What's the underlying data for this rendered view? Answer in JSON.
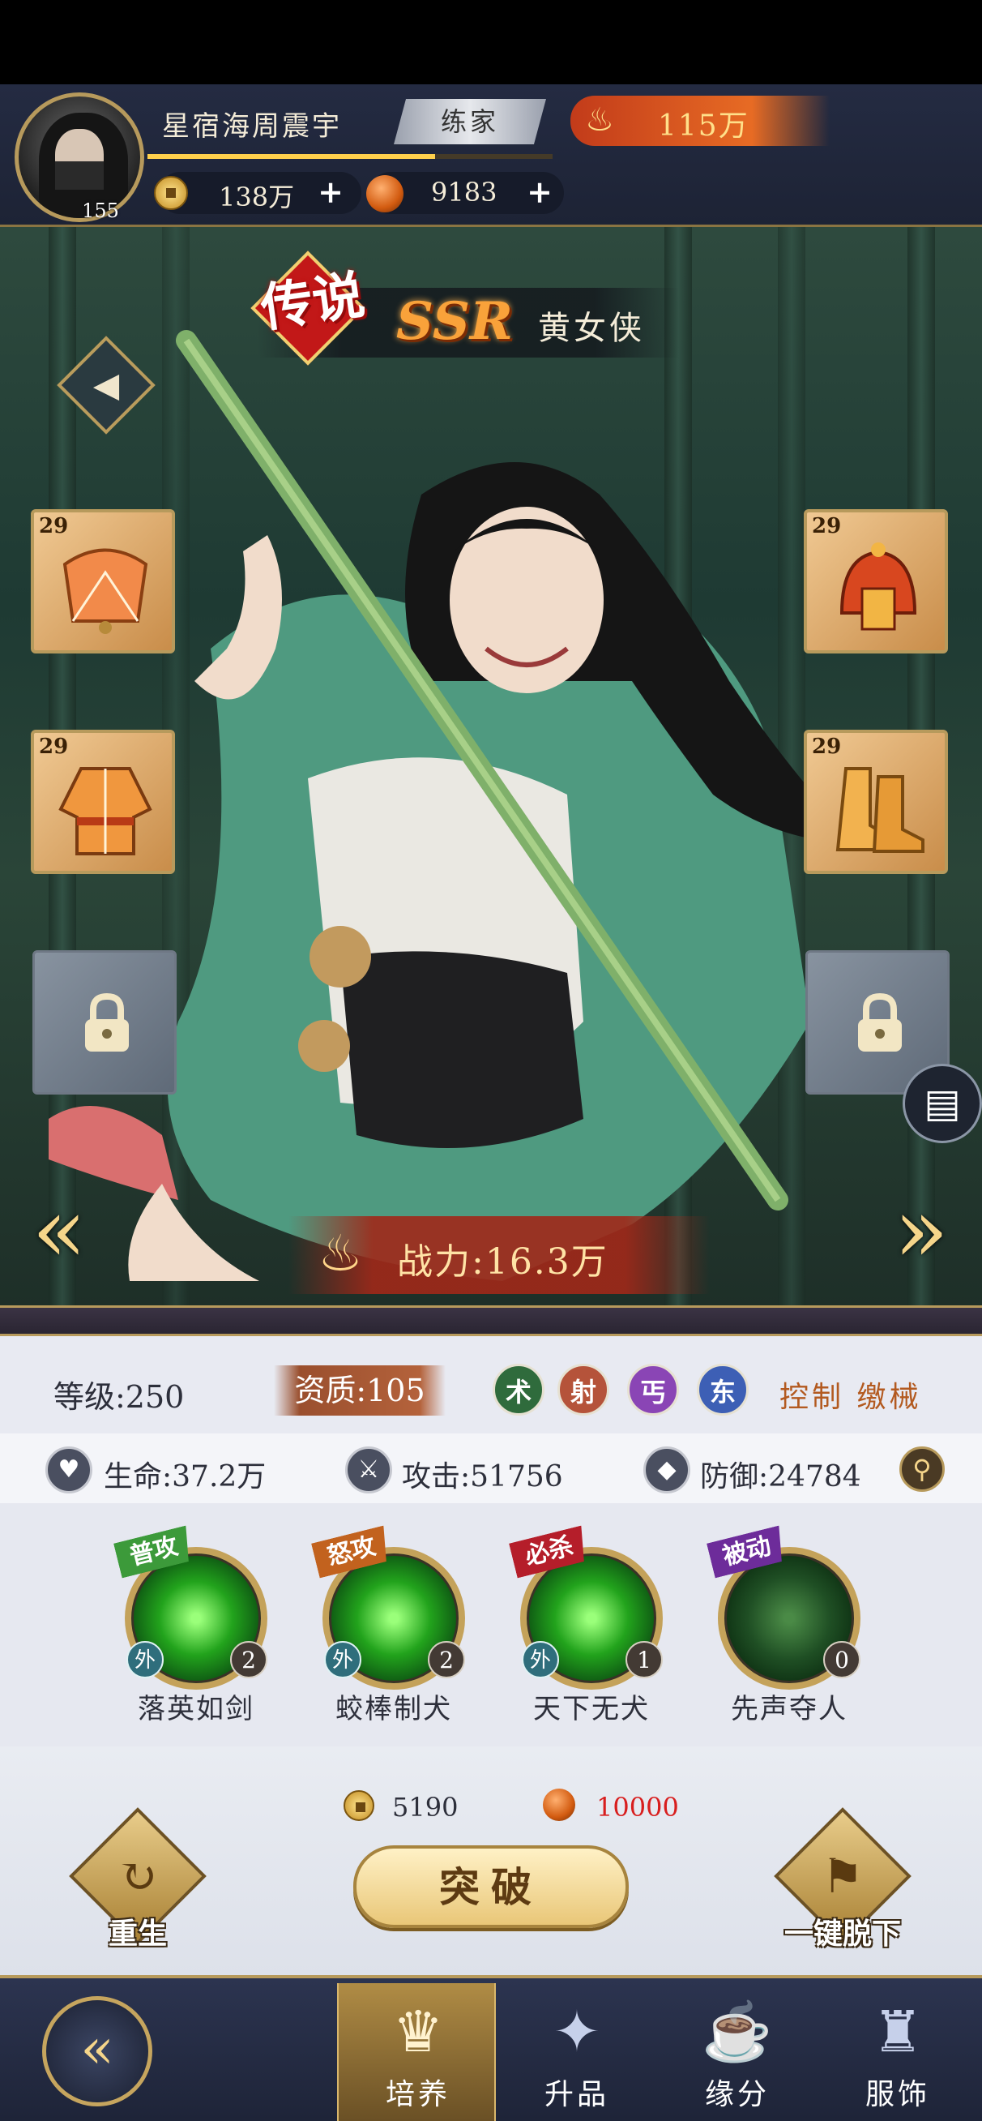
{
  "header": {
    "avatar_level": "155",
    "player_name": "星宿海周震宇",
    "rank_title": "练家",
    "power": "115万",
    "coins": "138万",
    "gems": "9183"
  },
  "hero": {
    "rarity_tag": "传说",
    "grade": "SSR",
    "name": "黄女侠",
    "combat_power": "战力:16.3万",
    "equipment": [
      {
        "slot": "fan",
        "level": "29"
      },
      {
        "slot": "helmet",
        "level": "29"
      },
      {
        "slot": "robe",
        "level": "29"
      },
      {
        "slot": "boots",
        "level": "29"
      }
    ]
  },
  "stats": {
    "level": "等级:250",
    "quality": "资质:105",
    "tags": [
      {
        "text": "术",
        "color": "#2f6b3c"
      },
      {
        "text": "射",
        "color": "#b5533a"
      },
      {
        "text": "丐",
        "color": "#8a45b5"
      },
      {
        "text": "东",
        "color": "#3d5fb5"
      }
    ],
    "roles": "控制 缴械",
    "hp": "生命:37.2万",
    "attack": "攻击:51756",
    "defense": "防御:24784"
  },
  "skills": [
    {
      "type": "普攻",
      "type_color": "#3c9a3a",
      "name": "落英如剑",
      "attr": "外",
      "count": "2"
    },
    {
      "type": "怒攻",
      "type_color": "#c2621e",
      "name": "蛟棒制犬",
      "attr": "外",
      "count": "2"
    },
    {
      "type": "必杀",
      "type_color": "#b51e2a",
      "name": "天下无犬",
      "attr": "外",
      "count": "1"
    },
    {
      "type": "被动",
      "type_color": "#6d2c9a",
      "name": "先声夺人",
      "attr": "",
      "count": "0"
    }
  ],
  "costs": {
    "coin": "5190",
    "gem": "10000",
    "gem_color": "#d81e1e"
  },
  "actions": {
    "rebirth": "重生",
    "breakthrough": "突破",
    "unequip_all": "一键脱下"
  },
  "nav": {
    "tabs": [
      "培养",
      "升品",
      "缘分",
      "服饰"
    ]
  }
}
